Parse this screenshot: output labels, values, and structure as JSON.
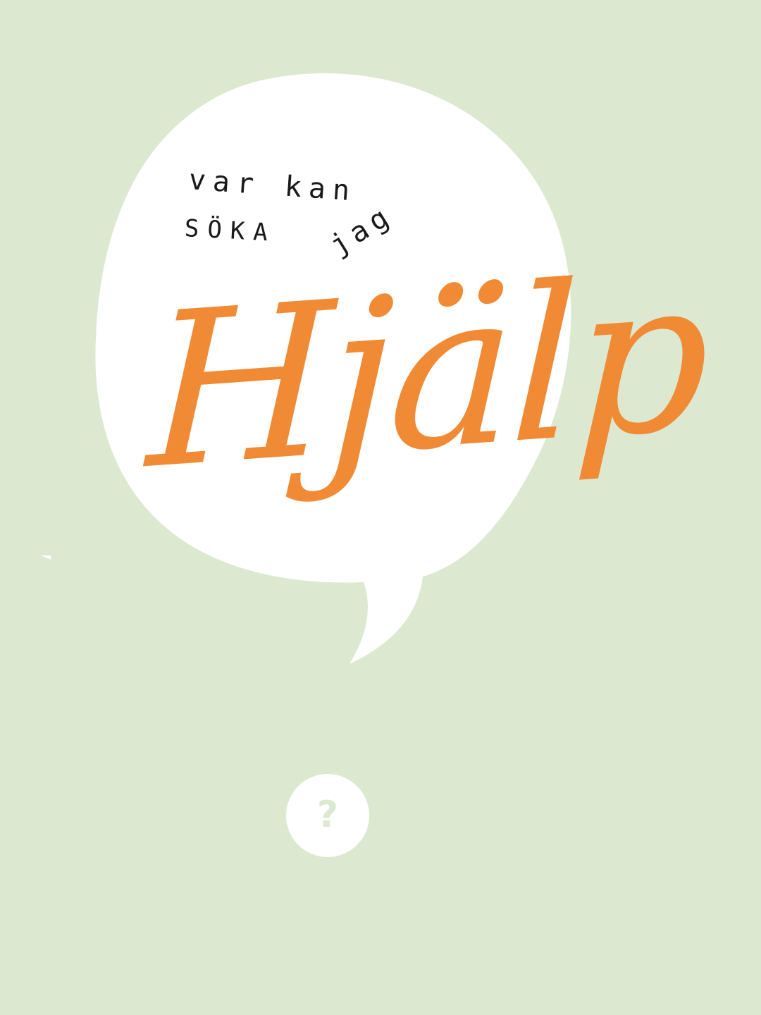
{
  "screen": {
    "background_color": "#dce9d0",
    "bubble_color": "#ffffff",
    "accent_color": "#f08a35"
  },
  "bubble": {
    "line_1": "var kan",
    "line_jag": "jag",
    "line_2": "SÖKA",
    "headline": "Hjälp"
  },
  "help_button": {
    "icon": "question-mark-icon",
    "glyph": "?"
  }
}
